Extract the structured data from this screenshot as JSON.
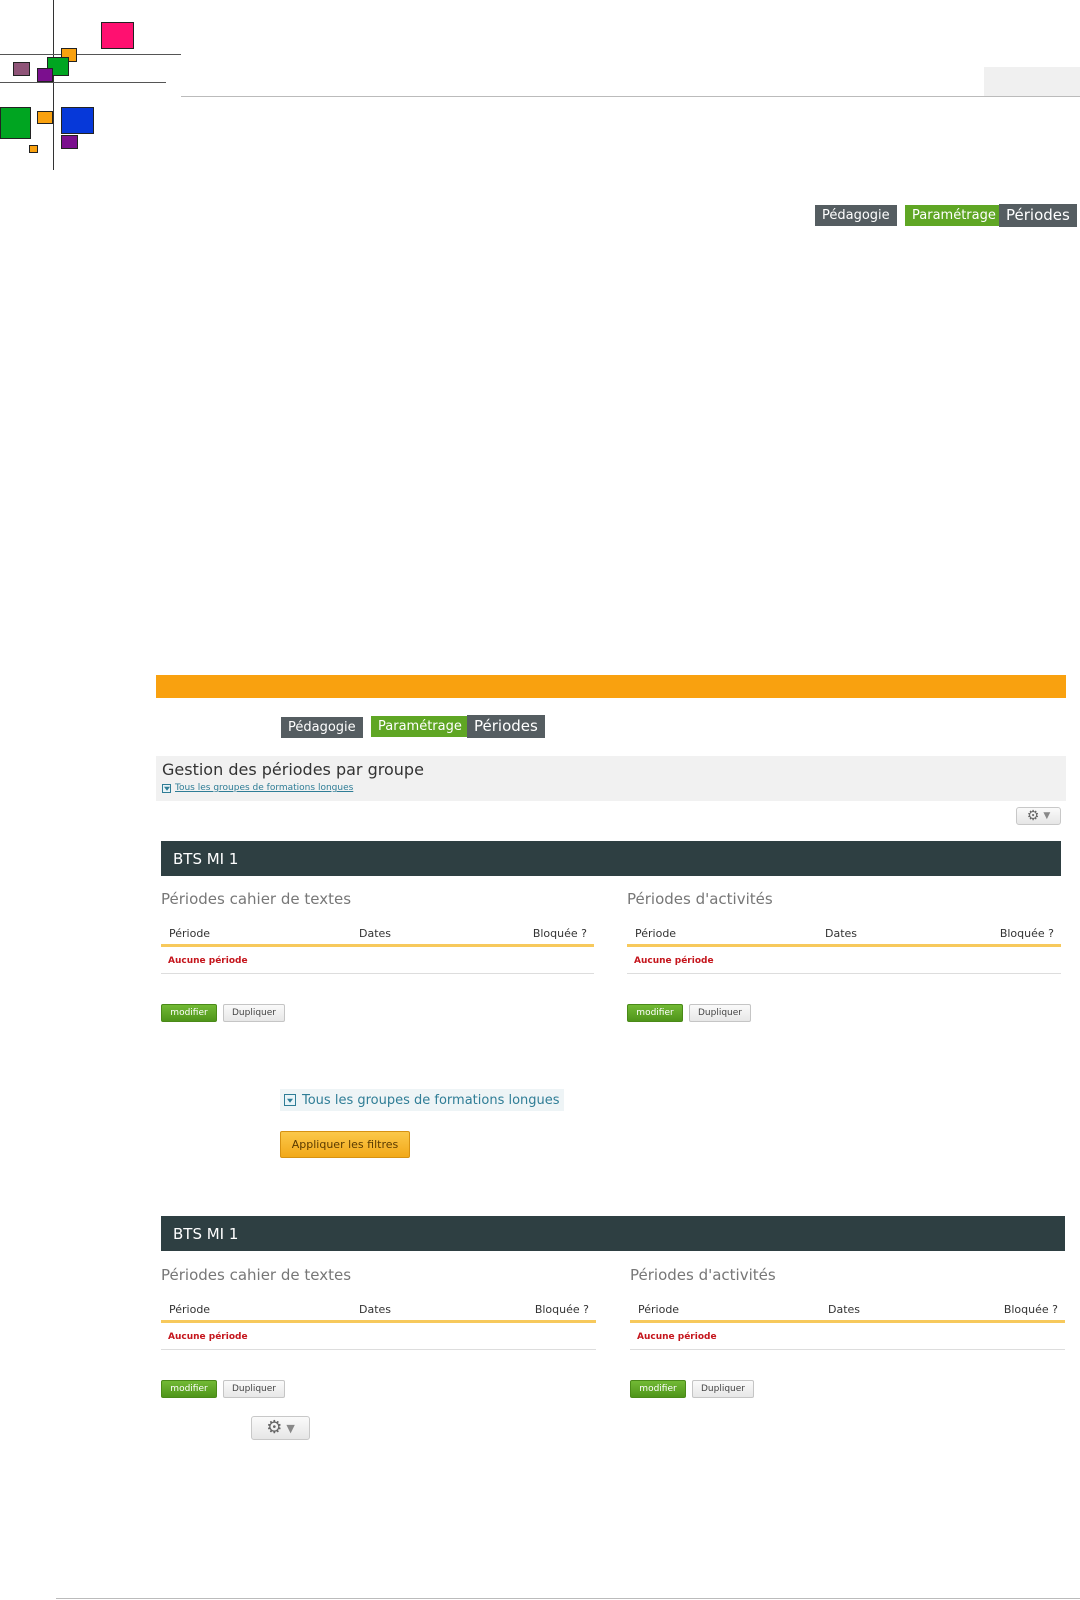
{
  "colors": {
    "orange_bar": "#f9a10f",
    "group_bar": "#2e3f42",
    "crumb_dark": "#555d61",
    "crumb_green": "#5fa624",
    "no_period_text": "#c5161d",
    "table_underline": "#f7c95c"
  },
  "logo": {
    "squares": [
      "#ff1070",
      "#f9a10f",
      "#00a521",
      "#8f5478",
      "#7b0f8e",
      "#f9a10f",
      "#00a521",
      "#0638d9",
      "#7b0f8e",
      "#f9a10f"
    ]
  },
  "breadcrumb_top": {
    "items": [
      "Pédagogie",
      "Paramétrage",
      "Périodes"
    ]
  },
  "breadcrumb_mid": {
    "items": [
      "Pédagogie",
      "Paramétrage",
      "Périodes"
    ]
  },
  "page": {
    "title": "Gestion des périodes par groupe",
    "filter_link": "Tous les groupes de formations longues",
    "settings_icon": "gear-icon"
  },
  "groups": [
    {
      "name": "BTS MI 1",
      "sections": [
        {
          "title": "Périodes cahier de textes",
          "columns": [
            "Période",
            "Dates",
            "Bloquée ?"
          ],
          "empty_text": "Aucune période",
          "modify_label": "modifier",
          "duplicate_label": "Dupliquer"
        },
        {
          "title": "Périodes d'activités",
          "columns": [
            "Période",
            "Dates",
            "Bloquée ?"
          ],
          "empty_text": "Aucune période",
          "modify_label": "modifier",
          "duplicate_label": "Dupliquer"
        }
      ]
    },
    {
      "name": "BTS MI 1",
      "sections": [
        {
          "title": "Périodes cahier de textes",
          "columns": [
            "Période",
            "Dates",
            "Bloquée ?"
          ],
          "empty_text": "Aucune période",
          "modify_label": "modifier",
          "duplicate_label": "Dupliquer"
        },
        {
          "title": "Périodes d'activités",
          "columns": [
            "Période",
            "Dates",
            "Bloquée ?"
          ],
          "empty_text": "Aucune période",
          "modify_label": "modifier",
          "duplicate_label": "Dupliquer"
        }
      ]
    }
  ],
  "filters": {
    "link": "Tous les groupes de formations longues",
    "apply_label": "Appliquer les filtres"
  },
  "icons": {
    "gear": "⚙",
    "dropdown": "▼"
  }
}
